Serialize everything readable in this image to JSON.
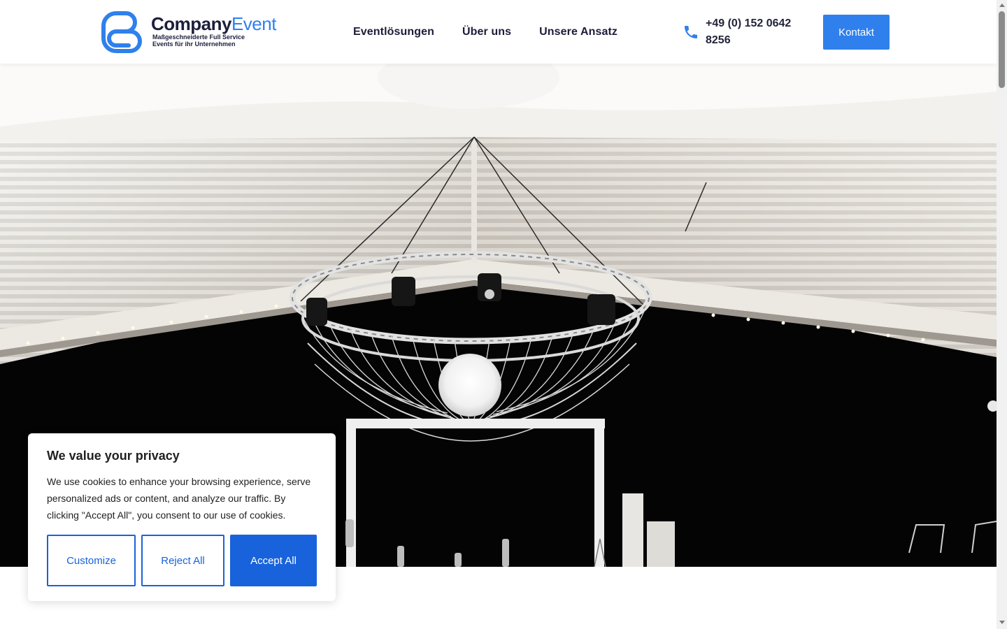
{
  "header": {
    "logo": {
      "name_part1": "Company",
      "name_part2": "Event",
      "tagline_line1": "Maßgeschneiderte Full Service",
      "tagline_line2": "Events für ihr Unternehmen"
    },
    "nav": [
      {
        "label": "Eventlösungen"
      },
      {
        "label": "Über uns"
      },
      {
        "label": "Unsere Ansatz"
      }
    ],
    "phone": {
      "icon": "phone-icon",
      "number": "+49 (0) 152 0642 8256"
    },
    "contact_button": "Kontakt"
  },
  "hero": {
    "image": "event-tent-chandelier-photo"
  },
  "cookie_banner": {
    "title": "We value your privacy",
    "text": "We use cookies to enhance your browsing experience, serve personalized ads or content, and analyze our traffic. By clicking \"Accept All\", you consent to our use of cookies.",
    "buttons": {
      "customize": "Customize",
      "reject": "Reject All",
      "accept": "Accept All"
    }
  },
  "colors": {
    "accent": "#2f80ed",
    "cookie_accent": "#1863dc",
    "nav_text": "#1c1c3a"
  }
}
